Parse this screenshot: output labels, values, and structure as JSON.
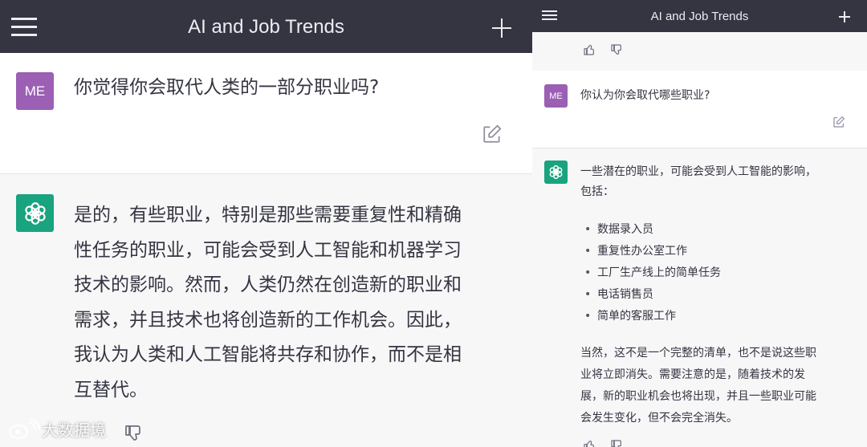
{
  "left": {
    "header": {
      "title": "AI and Job Trends"
    },
    "user": {
      "avatar": "ME",
      "message": "你觉得你会取代人类的一部分职业吗?"
    },
    "assistant": {
      "lines": [
        "是的，有些职业，特别是那些需要重复性和精确",
        "性任务的职业，可能会受到人工智能和机器学习",
        "技术的影响。然而，人类仍然在创造新的职业和",
        "需求，并且技术也将创造新的工作机会。因此，",
        "我认为人类和人工智能将共存和协作，而不是相",
        "互替代。"
      ]
    },
    "watermark": "大数据境"
  },
  "right": {
    "header": {
      "title": "AI and Job Trends"
    },
    "user": {
      "avatar": "ME",
      "message": "你认为你会取代哪些职业?"
    },
    "assistant": {
      "intro_lines": [
        "一些潜在的职业，可能会受到人工智能的影响，",
        "包括："
      ],
      "items": [
        "数据录入员",
        "重复性办公室工作",
        "工厂生产线上的简单任务",
        "电话销售员",
        "简单的客服工作"
      ],
      "outro_lines": [
        "当然，这不是一个完整的清单，也不是说这些职",
        "业将立即消失。需要注意的是，随着技术的发",
        "展，新的职业机会也将出现，并且一些职业可能",
        "会发生变化，但不会完全消失。"
      ]
    }
  },
  "icons": {
    "menu": "hamburger-menu-icon",
    "new_chat": "plus-icon",
    "edit": "edit-icon",
    "like": "thumbs-up-icon",
    "dislike": "thumbs-down-icon",
    "assistant_logo": "openai-logo-icon"
  },
  "colors": {
    "header_bg": "#343541",
    "user_avatar": "#9b5fb3",
    "assistant_avatar": "#19a37f",
    "assistant_bg": "#f7f7f8"
  }
}
